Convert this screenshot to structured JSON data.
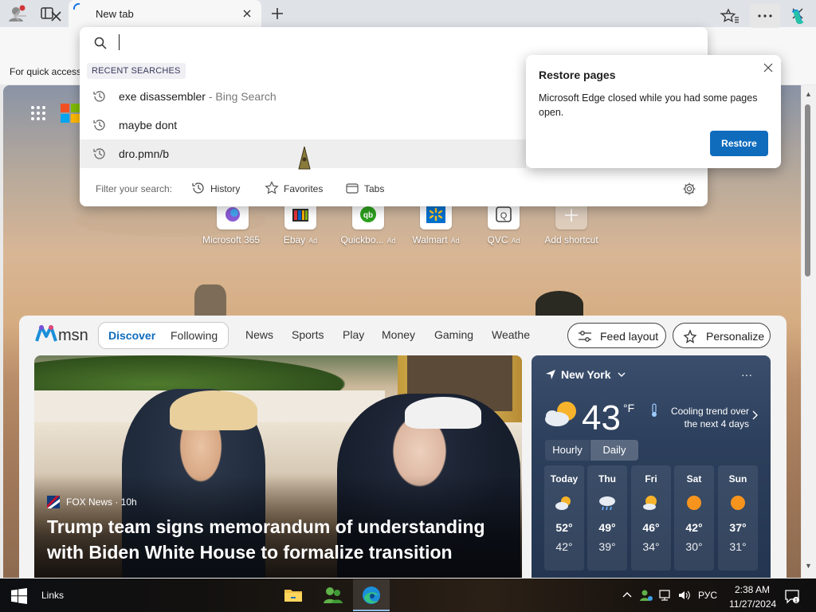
{
  "browser": {
    "tab_title": "New tab",
    "favorites_hint": "For quick access"
  },
  "omnibox": {
    "value": "",
    "recent_label": "RECENT SEARCHES",
    "suggestions": [
      {
        "text": "exe disassembler",
        "sub": " - Bing Search"
      },
      {
        "text": "maybe dont",
        "sub": ""
      },
      {
        "text": "dro.pmn/b",
        "sub": ""
      }
    ],
    "filter_label": "Filter your search:",
    "filters": [
      "History",
      "Favorites",
      "Tabs"
    ]
  },
  "restore_popup": {
    "title": "Restore pages",
    "body": "Microsoft Edge closed while you had some pages open.",
    "button": "Restore"
  },
  "shortcuts": [
    {
      "label": "Microsoft 365",
      "ad": ""
    },
    {
      "label": "Ebay",
      "ad": "Ad"
    },
    {
      "label": "Quickbo...",
      "ad": "Ad"
    },
    {
      "label": "Walmart",
      "ad": "Ad"
    },
    {
      "label": "QVC",
      "ad": "Ad"
    },
    {
      "label": "Add shortcut",
      "ad": ""
    }
  ],
  "feed": {
    "tabs": [
      "Discover",
      "Following"
    ],
    "categories": [
      "News",
      "Sports",
      "Play",
      "Money",
      "Gaming",
      "Weathe"
    ],
    "feed_layout": "Feed layout",
    "personalize": "Personalize"
  },
  "hero": {
    "source": "FOX News · 10h",
    "headline": "Trump team signs memorandum of understanding with Biden White House to formalize transition"
  },
  "weather": {
    "location": "New York",
    "temp": "43",
    "unit": "°F",
    "trend": "Cooling trend over the next 4 days",
    "hourly": "Hourly",
    "daily": "Daily",
    "days": [
      {
        "name": "Today",
        "hi": "52°",
        "lo": "42°",
        "icon": "partly-sunny-icon"
      },
      {
        "name": "Thu",
        "hi": "49°",
        "lo": "39°",
        "icon": "rain-icon"
      },
      {
        "name": "Fri",
        "hi": "46°",
        "lo": "34°",
        "icon": "partly-sunny-icon"
      },
      {
        "name": "Sat",
        "hi": "42°",
        "lo": "30°",
        "icon": "sun-icon"
      },
      {
        "name": "Sun",
        "hi": "37°",
        "lo": "31°",
        "icon": "sun-icon"
      }
    ]
  },
  "taskbar": {
    "links": "Links",
    "lang": "РУС",
    "time": "2:38 AM",
    "date": "11/27/2024"
  },
  "colors": {
    "accent": "#0f6cbd",
    "discover": "#0f6cbd",
    "weather_bg": "#2c3f5c"
  }
}
